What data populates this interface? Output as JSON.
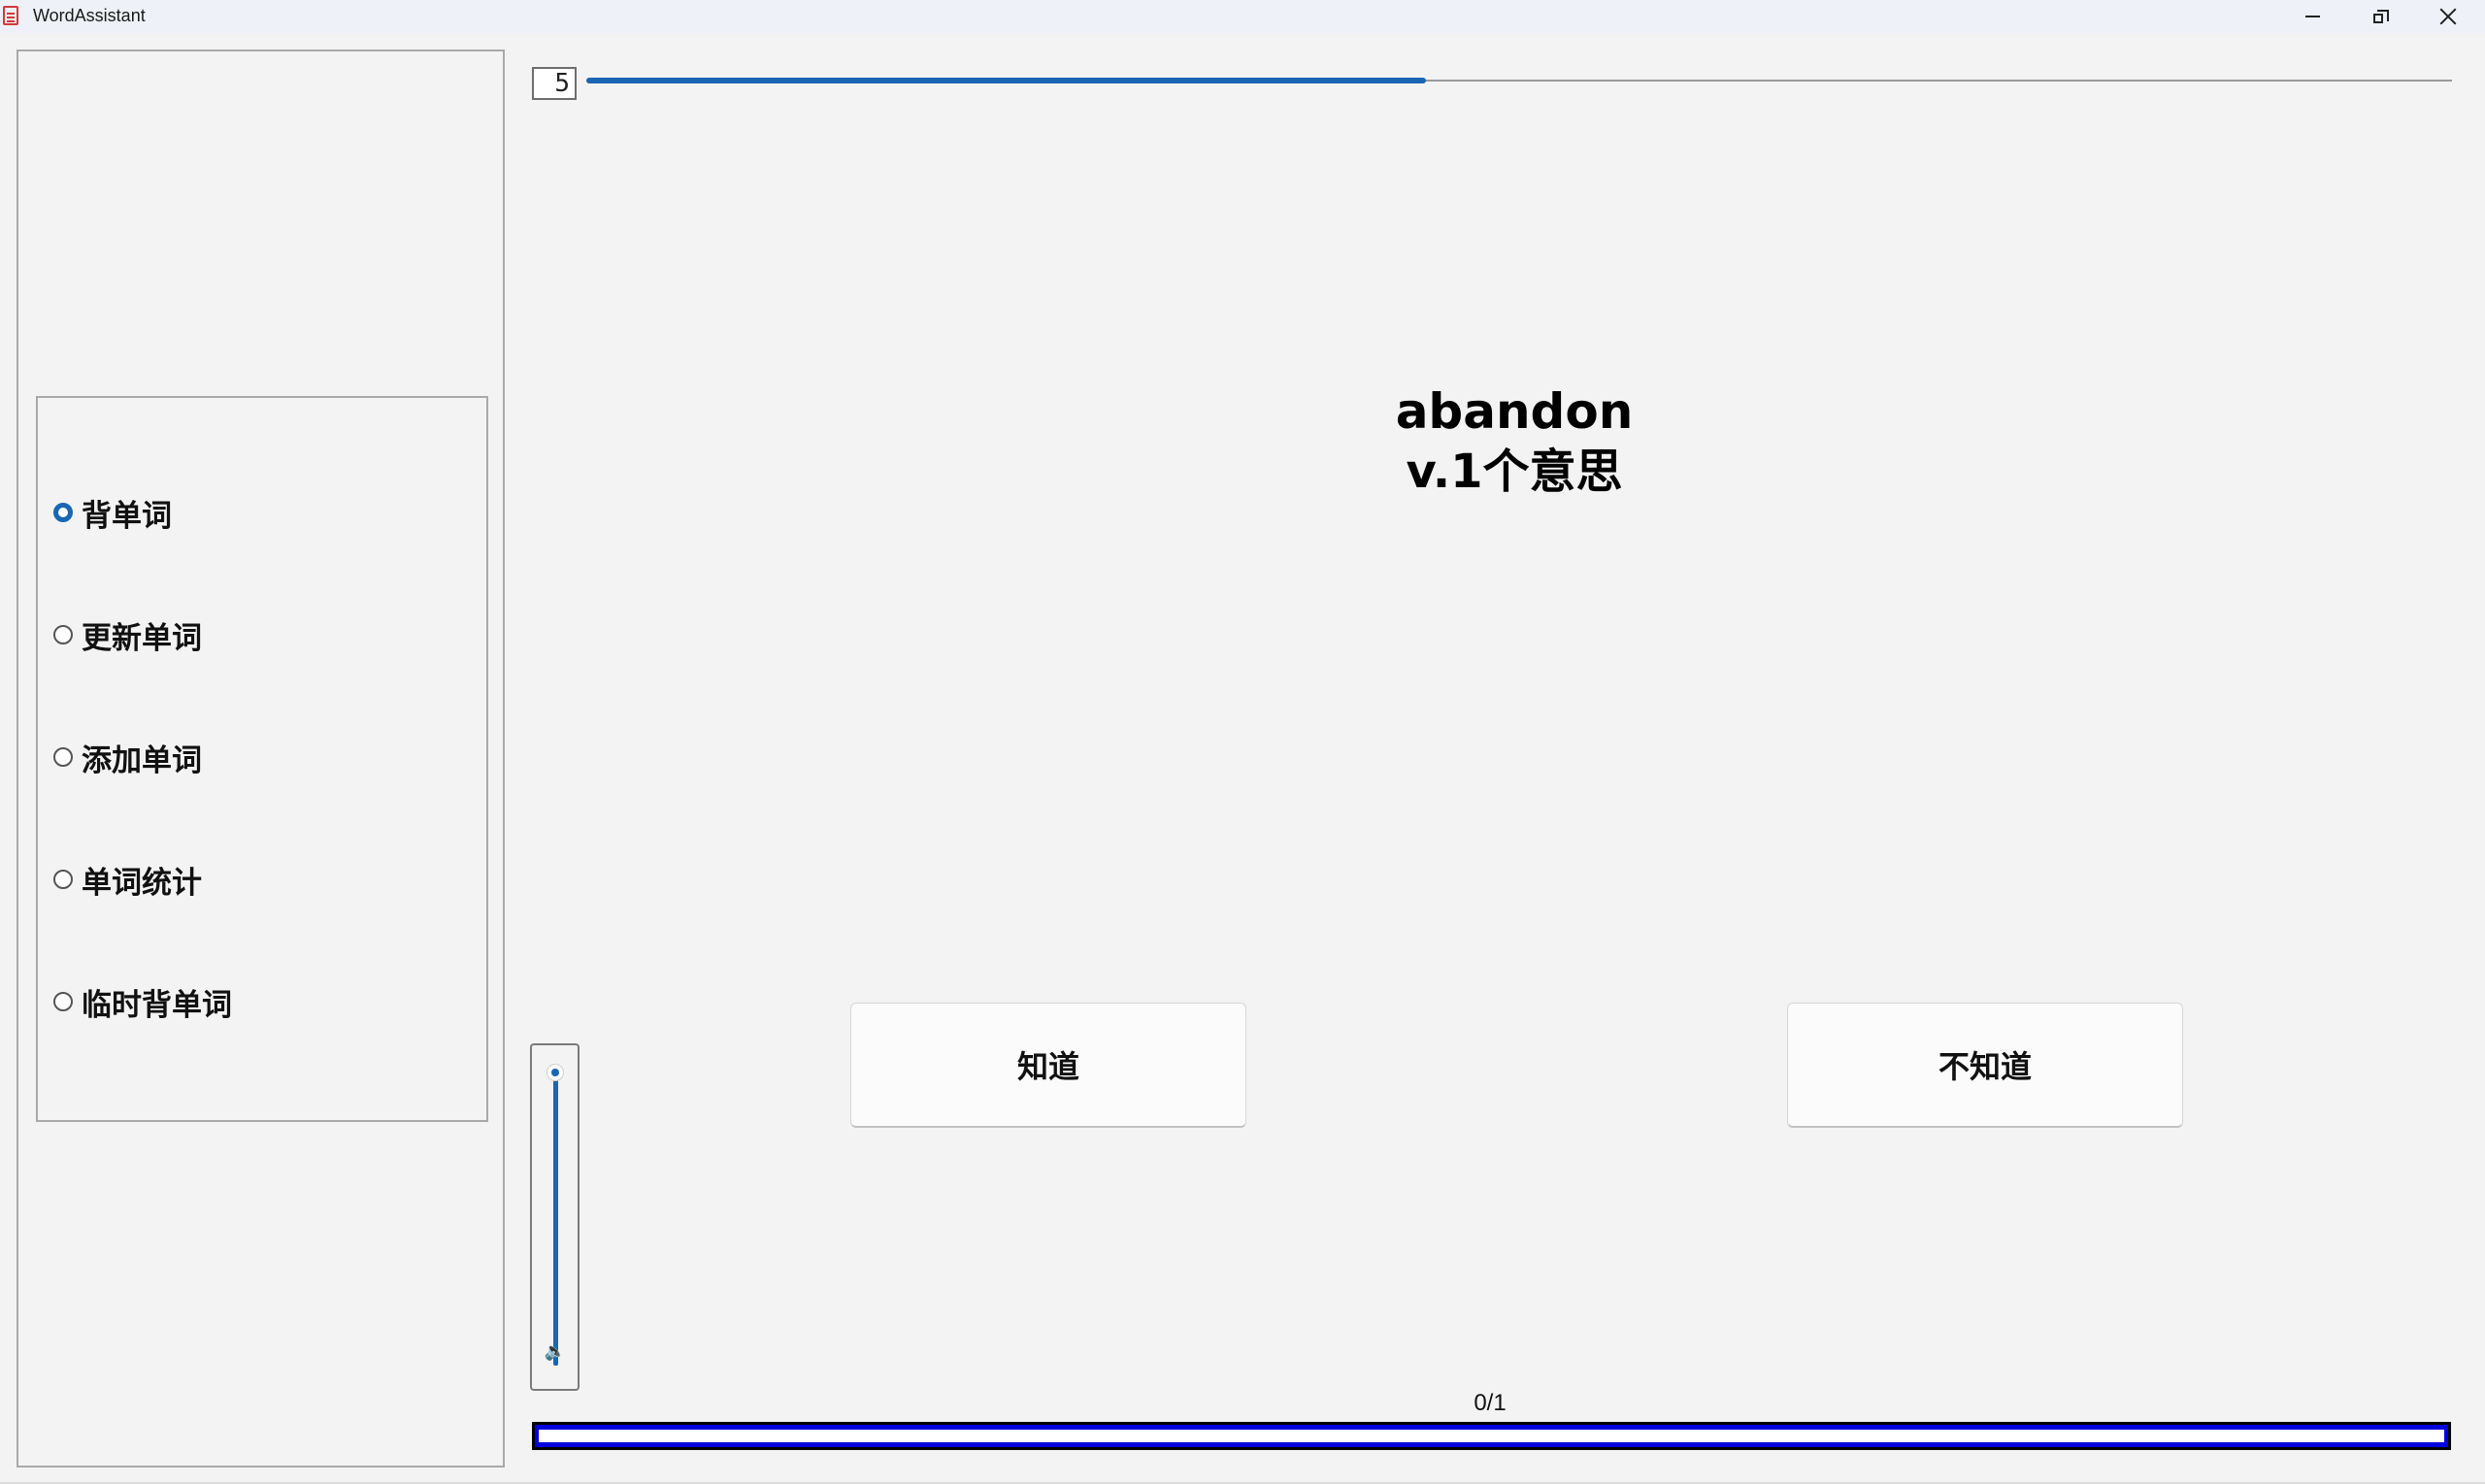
{
  "window": {
    "title": "WordAssistant",
    "controls": [
      "minimize",
      "restore",
      "close"
    ]
  },
  "sidebar": {
    "items": [
      {
        "label": "背单词",
        "checked": true
      },
      {
        "label": "更新单词",
        "checked": false
      },
      {
        "label": "添加单词",
        "checked": false
      },
      {
        "label": "单词统计",
        "checked": false
      },
      {
        "label": "临时背单词",
        "checked": false
      }
    ]
  },
  "top": {
    "counter_value": "5",
    "slider_fraction": 0.45
  },
  "card": {
    "word": "abandon",
    "meaning": "v.1个意思"
  },
  "buttons": {
    "know_label": "知道",
    "dont_know_label": "不知道"
  },
  "volume": {
    "level_fraction": 1.0,
    "icon": "speaker-icon"
  },
  "progress": {
    "label": "0/1",
    "fraction": 0.0
  },
  "colors": {
    "accent": "#1a66b3",
    "progress_blue": "#0000dd",
    "background": "#f3f3f3"
  }
}
